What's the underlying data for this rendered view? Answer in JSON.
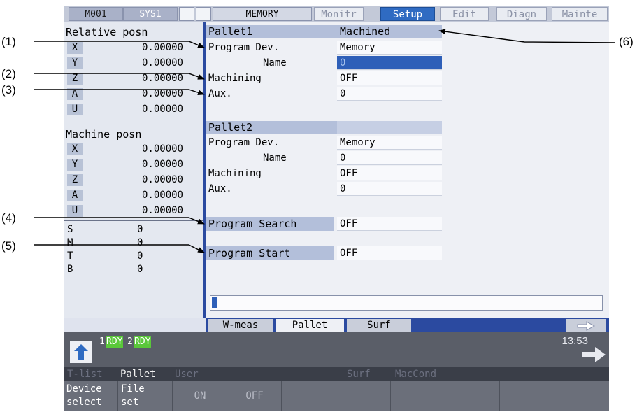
{
  "callouts": {
    "c1": "(1)",
    "c2": "(2)",
    "c3": "(3)",
    "c4": "(4)",
    "c5": "(5)",
    "c6": "(6)"
  },
  "topbar": {
    "status1": "M001",
    "status2": "SYS1",
    "mode": "MEMORY",
    "tabs": [
      "Monitr",
      "Setup",
      "Edit",
      "Diagn",
      "Mainte"
    ],
    "active_tab": "Setup"
  },
  "left": {
    "relative_title": "Relative posn",
    "relative": [
      {
        "axis": "X",
        "value": "0.00000"
      },
      {
        "axis": "Y",
        "value": "0.00000"
      },
      {
        "axis": "Z",
        "value": "0.00000"
      },
      {
        "axis": "A",
        "value": "0.00000"
      },
      {
        "axis": "U",
        "value": "0.00000"
      }
    ],
    "machine_title": "Machine posn",
    "machine": [
      {
        "axis": "X",
        "value": "0.00000"
      },
      {
        "axis": "Y",
        "value": "0.00000"
      },
      {
        "axis": "Z",
        "value": "0.00000"
      },
      {
        "axis": "A",
        "value": "0.00000"
      },
      {
        "axis": "U",
        "value": "0.00000"
      }
    ],
    "modal": [
      {
        "label": "S",
        "value": "0"
      },
      {
        "label": "M",
        "value": "0"
      },
      {
        "label": "T",
        "value": "0"
      },
      {
        "label": "B",
        "value": "0"
      }
    ]
  },
  "pallet1": {
    "title": "Pallet1",
    "status": "Machined",
    "program_dev_label": "Program Dev.",
    "program_dev_value": "Memory",
    "name_label": "Name",
    "name_value": "0",
    "machining_label": "Machining",
    "machining_value": "OFF",
    "aux_label": "Aux.",
    "aux_value": "0"
  },
  "pallet2": {
    "title": "Pallet2",
    "program_dev_label": "Program Dev.",
    "program_dev_value": "Memory",
    "name_label": "Name",
    "name_value": "0",
    "machining_label": "Machining",
    "machining_value": "OFF",
    "aux_label": "Aux.",
    "aux_value": "0"
  },
  "program_search": {
    "label": "Program Search",
    "value": "OFF"
  },
  "program_start": {
    "label": "Program Start",
    "value": "OFF"
  },
  "subtabs": [
    "W-meas",
    "Pallet",
    "Surf"
  ],
  "status": {
    "rdy1_num": "1",
    "rdy1": "RDY",
    "rdy2_num": "2",
    "rdy2": "RDY",
    "clock": "13:53"
  },
  "menu": [
    "T-list",
    "Pallet",
    "User",
    "Surf",
    "MacCond"
  ],
  "softkeys": {
    "k1_line1": "Device",
    "k1_line2": "select",
    "k2_line1": "File",
    "k2_line2": "set",
    "k3": "ON",
    "k4": "OFF"
  },
  "colors": {
    "active_tab": "#2f6bc2",
    "divider": "#2b4aa0",
    "rdy_badge": "#5ac83a",
    "selected_field": "#2e5fb8"
  }
}
